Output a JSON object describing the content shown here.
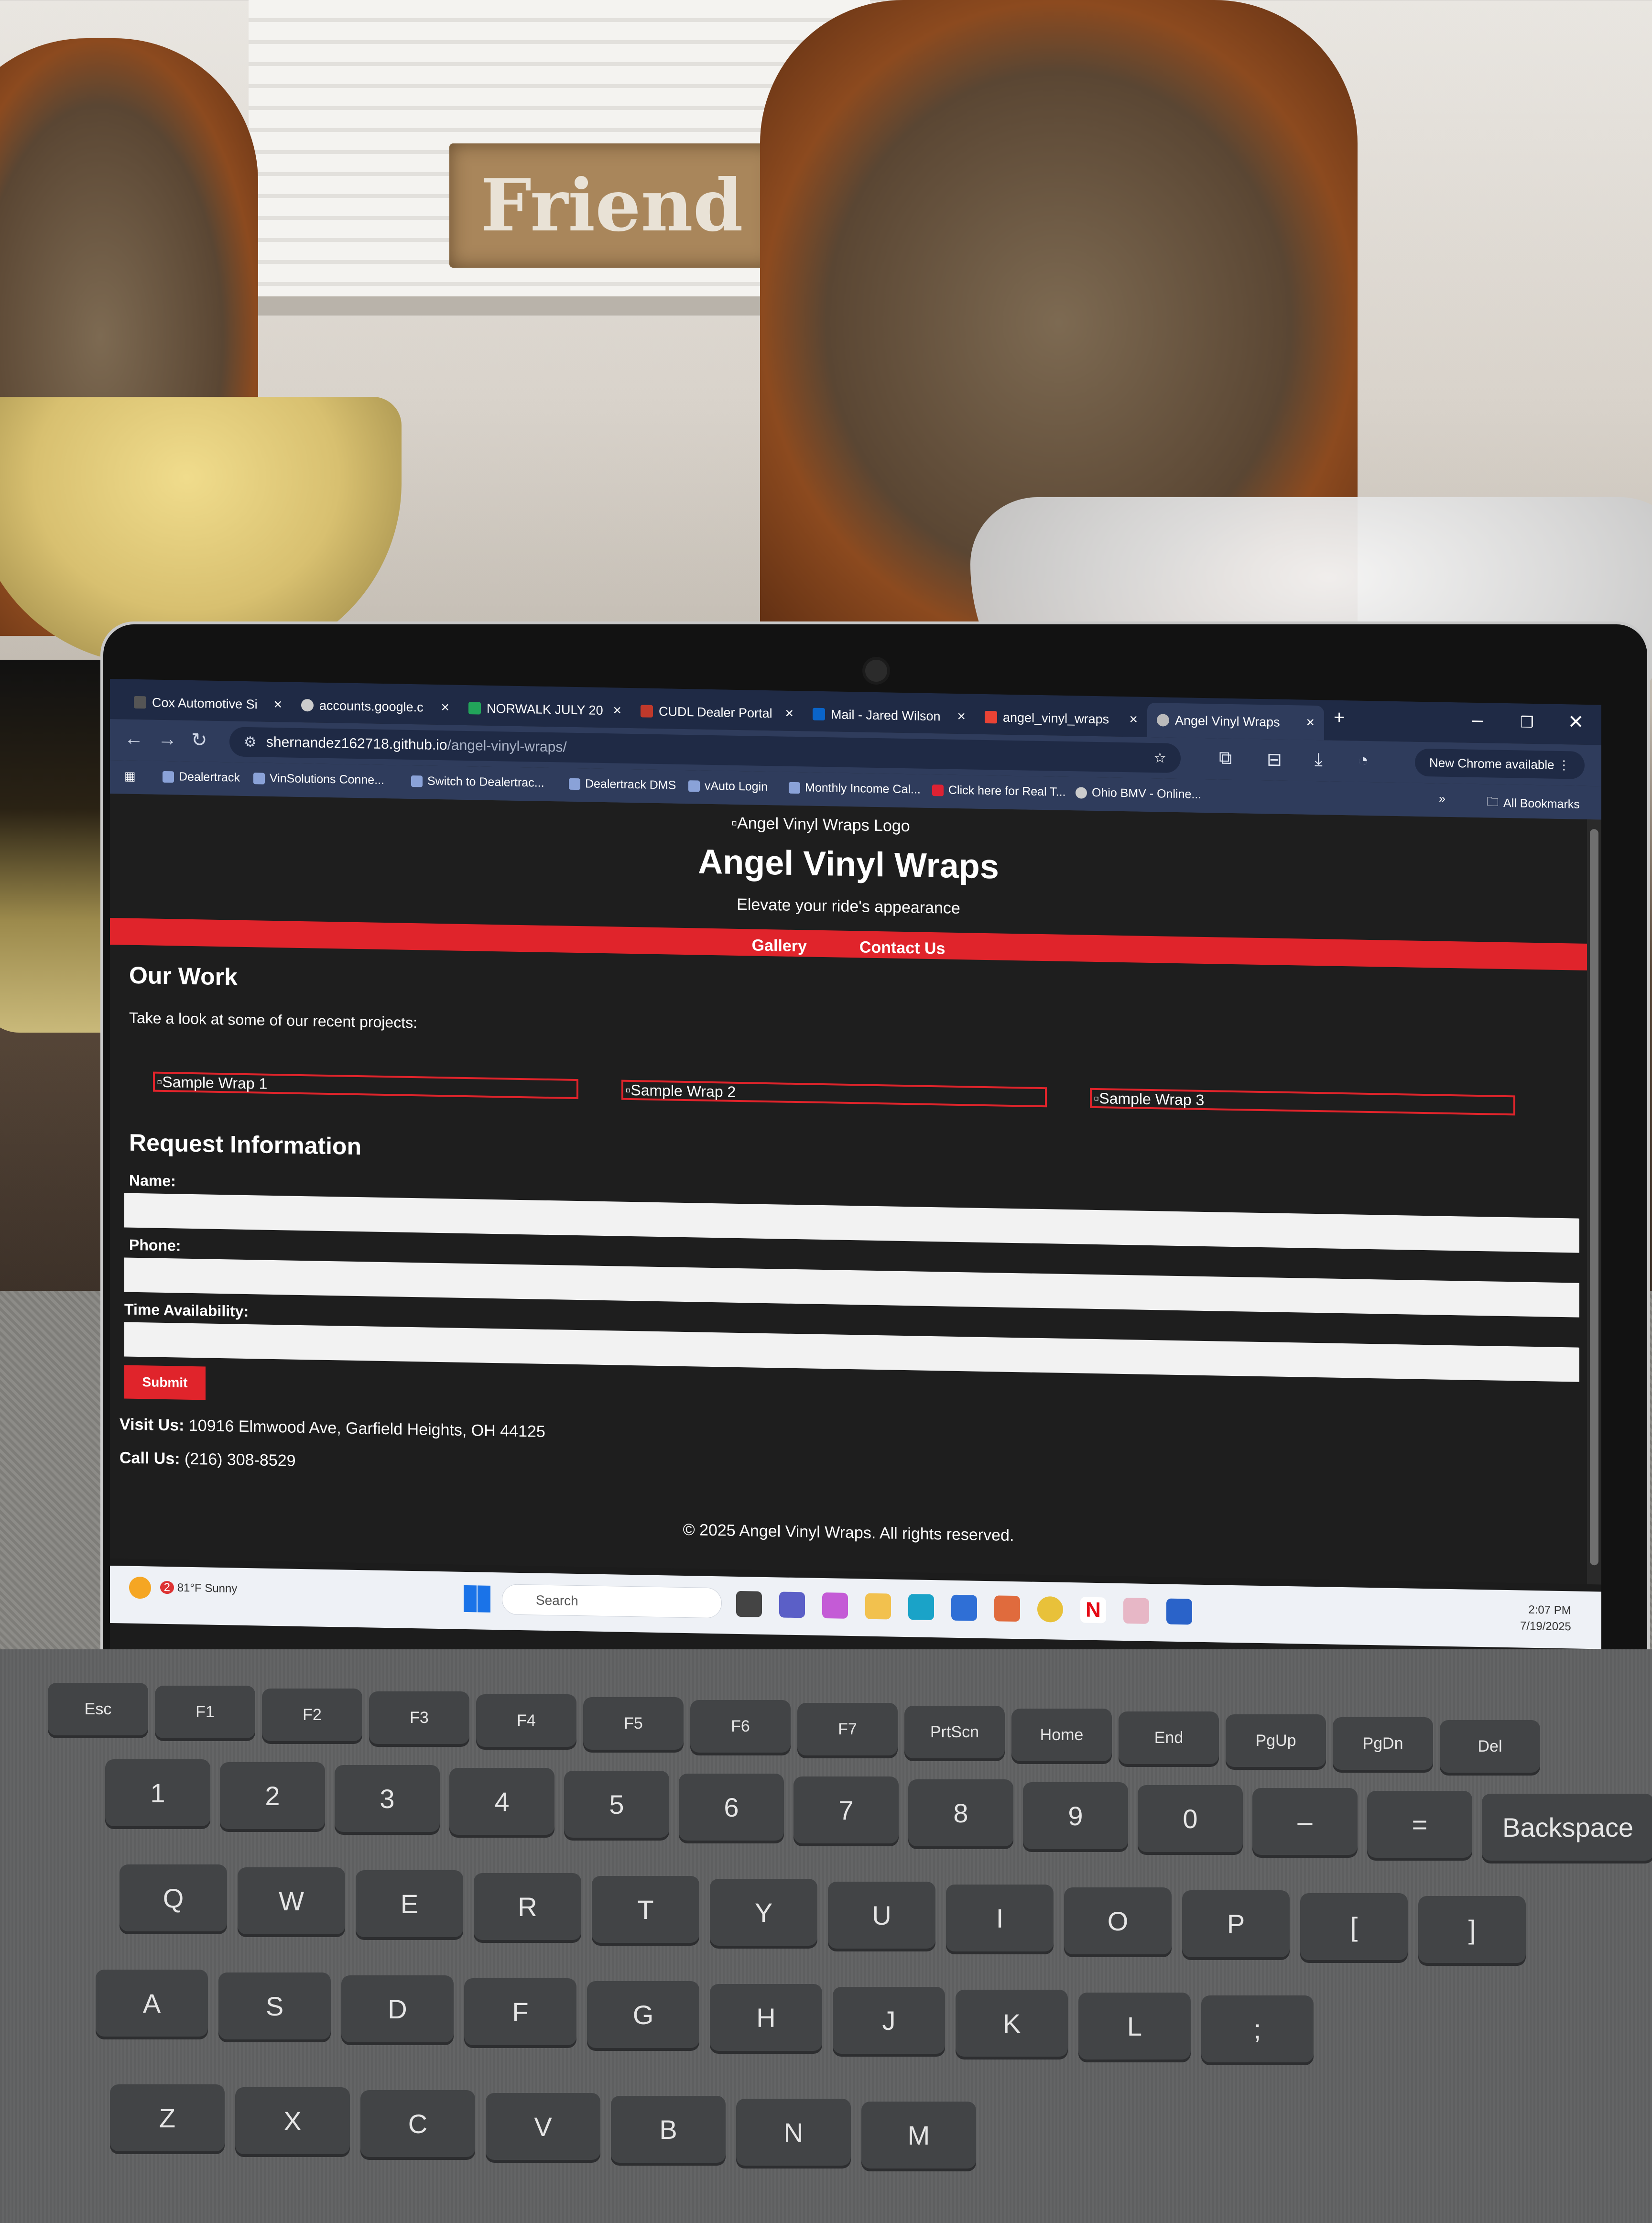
{
  "browser": {
    "tabs": [
      {
        "title": "Cox Automotive Si"
      },
      {
        "title": "accounts.google.c"
      },
      {
        "title": "NORWALK JULY 20"
      },
      {
        "title": "CUDL Dealer Portal"
      },
      {
        "title": "Mail - Jared Wilson"
      },
      {
        "title": "angel_vinyl_wraps"
      },
      {
        "title": "Angel Vinyl Wraps"
      }
    ],
    "url_host": "shernandez162718.github.io",
    "url_path": "/angel-vinyl-wraps/",
    "update_button": "New Chrome available",
    "bookmarks": [
      {
        "label": "Dealertrack"
      },
      {
        "label": "VinSolutions Conne..."
      },
      {
        "label": "Switch to Dealertrac..."
      },
      {
        "label": "Dealertrack DMS"
      },
      {
        "label": "vAuto Login"
      },
      {
        "label": "Monthly Income Cal..."
      },
      {
        "label": "Click here for Real T..."
      },
      {
        "label": "Ohio BMV - Online..."
      }
    ],
    "all_bookmarks": "All Bookmarks"
  },
  "site": {
    "logo_alt": "Angel Vinyl Wraps Logo",
    "title": "Angel Vinyl Wraps",
    "tagline": "Elevate your ride's appearance",
    "nav": [
      "Gallery",
      "Contact Us"
    ],
    "work_heading": "Our Work",
    "work_intro": "Take a look at some of our recent projects:",
    "gallery": [
      "Sample Wrap 1",
      "Sample Wrap 2",
      "Sample Wrap 3"
    ],
    "form_heading": "Request Information",
    "fields": [
      {
        "label": "Name:",
        "value": ""
      },
      {
        "label": "Phone:",
        "value": ""
      },
      {
        "label": "Time Availability:",
        "value": ""
      }
    ],
    "submit": "Submit",
    "visit_label": "Visit Us:",
    "address": "10916 Elmwood Ave, Garfield Heights, OH 44125",
    "call_label": "Call Us:",
    "phone": "(216) 308-8529",
    "footer": "© 2025 Angel Vinyl Wraps. All rights reserved."
  },
  "taskbar": {
    "weather_badge": "2",
    "temperature": "81°F",
    "condition": "Sunny",
    "search_placeholder": "Search",
    "time": "2:07 PM",
    "date": "7/19/2025"
  },
  "background": {
    "sign_text": "Friend"
  },
  "keyboard": {
    "fn_row": [
      "Esc",
      "F1",
      "F2",
      "F3",
      "F4",
      "F5",
      "F6",
      "F7",
      "PrtScn",
      "Home",
      "End",
      "PgUp",
      "PgDn",
      "Del"
    ],
    "number_row": [
      "1",
      "2",
      "3",
      "4",
      "5",
      "6",
      "7",
      "8",
      "9",
      "0",
      "–",
      "=",
      "Backspace"
    ],
    "top_row": [
      "Q",
      "W",
      "E",
      "R",
      "T",
      "Y",
      "U",
      "I",
      "O",
      "P",
      "[",
      "]"
    ],
    "home_row": [
      "A",
      "S",
      "D",
      "F",
      "G",
      "H",
      "J",
      "K",
      "L",
      ";"
    ],
    "bottom_row": [
      "Z",
      "X",
      "C",
      "V",
      "B",
      "N",
      "M"
    ]
  },
  "colors": {
    "accent_red": "#e0242b",
    "page_bg": "#1e1e1e",
    "chrome_tab_bg": "#1f2a45"
  }
}
